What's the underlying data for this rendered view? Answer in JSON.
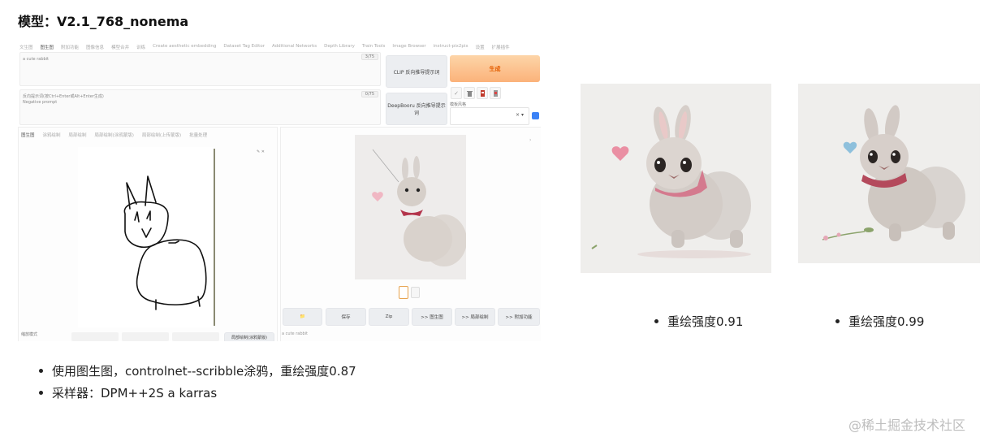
{
  "title": "模型：V2.1_768_nonema",
  "webui": {
    "top_tabs": [
      "文生图",
      "图生图",
      "附加功能",
      "图像信息",
      "模型合并",
      "训练",
      "Create aesthetic embedding",
      "Dataset Tag Editor",
      "Additional Networks",
      "Depth Library",
      "Train Tools",
      "Image Browser",
      "instruct-pix2pix",
      "设置",
      "扩展插件"
    ],
    "active_tab_index": 1,
    "prompt": {
      "value": "a cute rabbit",
      "counter": "3/75"
    },
    "negative_prompt": {
      "line1": "反向提示词(按Ctrl+Enter或Alt+Enter生成)",
      "line2": "Negative prompt",
      "counter": "0/75"
    },
    "clip_button": "CLIP 反向推导提示词",
    "deepbooru_button": "DeepBooru 反向推导提示词",
    "generate_button": "生成",
    "style_label": "模板风格",
    "style_clear": "× ▾",
    "sub_tabs": [
      "图生图",
      "涂鸦绘制",
      "局部绘制",
      "局部绘制(涂鸦蒙版)",
      "局部绘制(上传蒙版)",
      "批量处理"
    ],
    "active_sub_tab_index": 0,
    "canvas_tools": "✎ ✕",
    "action_buttons": [
      "📁",
      "保存",
      "Zip",
      ">> 图生图",
      ">> 局部绘制",
      ">> 附加功能"
    ],
    "output_caption": "a cute rabbit",
    "resize_label": "缩放模式",
    "bottom_button": "局部绘制(涂鸦蒙版)"
  },
  "bullets": [
    "使用图生图，controlnet--scribble涂鸦，重绘强度0.87",
    "采样器：DPM++2S a karras"
  ],
  "results": [
    {
      "caption": "重绘强度0.91",
      "heart_color": "#ea8fa3"
    },
    {
      "caption": "重绘强度0.99",
      "heart_color": "#8ec0dc"
    }
  ],
  "watermark": "@稀土掘金技术社区"
}
